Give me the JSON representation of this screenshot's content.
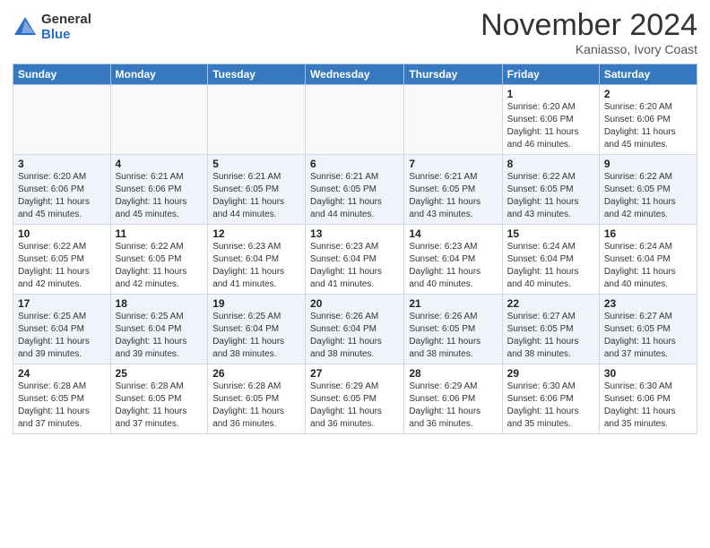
{
  "header": {
    "logo_general": "General",
    "logo_blue": "Blue",
    "month_title": "November 2024",
    "location": "Kaniasso, Ivory Coast"
  },
  "weekdays": [
    "Sunday",
    "Monday",
    "Tuesday",
    "Wednesday",
    "Thursday",
    "Friday",
    "Saturday"
  ],
  "weeks": [
    [
      {
        "day": "",
        "info": ""
      },
      {
        "day": "",
        "info": ""
      },
      {
        "day": "",
        "info": ""
      },
      {
        "day": "",
        "info": ""
      },
      {
        "day": "",
        "info": ""
      },
      {
        "day": "1",
        "info": "Sunrise: 6:20 AM\nSunset: 6:06 PM\nDaylight: 11 hours\nand 46 minutes."
      },
      {
        "day": "2",
        "info": "Sunrise: 6:20 AM\nSunset: 6:06 PM\nDaylight: 11 hours\nand 45 minutes."
      }
    ],
    [
      {
        "day": "3",
        "info": "Sunrise: 6:20 AM\nSunset: 6:06 PM\nDaylight: 11 hours\nand 45 minutes."
      },
      {
        "day": "4",
        "info": "Sunrise: 6:21 AM\nSunset: 6:06 PM\nDaylight: 11 hours\nand 45 minutes."
      },
      {
        "day": "5",
        "info": "Sunrise: 6:21 AM\nSunset: 6:05 PM\nDaylight: 11 hours\nand 44 minutes."
      },
      {
        "day": "6",
        "info": "Sunrise: 6:21 AM\nSunset: 6:05 PM\nDaylight: 11 hours\nand 44 minutes."
      },
      {
        "day": "7",
        "info": "Sunrise: 6:21 AM\nSunset: 6:05 PM\nDaylight: 11 hours\nand 43 minutes."
      },
      {
        "day": "8",
        "info": "Sunrise: 6:22 AM\nSunset: 6:05 PM\nDaylight: 11 hours\nand 43 minutes."
      },
      {
        "day": "9",
        "info": "Sunrise: 6:22 AM\nSunset: 6:05 PM\nDaylight: 11 hours\nand 42 minutes."
      }
    ],
    [
      {
        "day": "10",
        "info": "Sunrise: 6:22 AM\nSunset: 6:05 PM\nDaylight: 11 hours\nand 42 minutes."
      },
      {
        "day": "11",
        "info": "Sunrise: 6:22 AM\nSunset: 6:05 PM\nDaylight: 11 hours\nand 42 minutes."
      },
      {
        "day": "12",
        "info": "Sunrise: 6:23 AM\nSunset: 6:04 PM\nDaylight: 11 hours\nand 41 minutes."
      },
      {
        "day": "13",
        "info": "Sunrise: 6:23 AM\nSunset: 6:04 PM\nDaylight: 11 hours\nand 41 minutes."
      },
      {
        "day": "14",
        "info": "Sunrise: 6:23 AM\nSunset: 6:04 PM\nDaylight: 11 hours\nand 40 minutes."
      },
      {
        "day": "15",
        "info": "Sunrise: 6:24 AM\nSunset: 6:04 PM\nDaylight: 11 hours\nand 40 minutes."
      },
      {
        "day": "16",
        "info": "Sunrise: 6:24 AM\nSunset: 6:04 PM\nDaylight: 11 hours\nand 40 minutes."
      }
    ],
    [
      {
        "day": "17",
        "info": "Sunrise: 6:25 AM\nSunset: 6:04 PM\nDaylight: 11 hours\nand 39 minutes."
      },
      {
        "day": "18",
        "info": "Sunrise: 6:25 AM\nSunset: 6:04 PM\nDaylight: 11 hours\nand 39 minutes."
      },
      {
        "day": "19",
        "info": "Sunrise: 6:25 AM\nSunset: 6:04 PM\nDaylight: 11 hours\nand 38 minutes."
      },
      {
        "day": "20",
        "info": "Sunrise: 6:26 AM\nSunset: 6:04 PM\nDaylight: 11 hours\nand 38 minutes."
      },
      {
        "day": "21",
        "info": "Sunrise: 6:26 AM\nSunset: 6:05 PM\nDaylight: 11 hours\nand 38 minutes."
      },
      {
        "day": "22",
        "info": "Sunrise: 6:27 AM\nSunset: 6:05 PM\nDaylight: 11 hours\nand 38 minutes."
      },
      {
        "day": "23",
        "info": "Sunrise: 6:27 AM\nSunset: 6:05 PM\nDaylight: 11 hours\nand 37 minutes."
      }
    ],
    [
      {
        "day": "24",
        "info": "Sunrise: 6:28 AM\nSunset: 6:05 PM\nDaylight: 11 hours\nand 37 minutes."
      },
      {
        "day": "25",
        "info": "Sunrise: 6:28 AM\nSunset: 6:05 PM\nDaylight: 11 hours\nand 37 minutes."
      },
      {
        "day": "26",
        "info": "Sunrise: 6:28 AM\nSunset: 6:05 PM\nDaylight: 11 hours\nand 36 minutes."
      },
      {
        "day": "27",
        "info": "Sunrise: 6:29 AM\nSunset: 6:05 PM\nDaylight: 11 hours\nand 36 minutes."
      },
      {
        "day": "28",
        "info": "Sunrise: 6:29 AM\nSunset: 6:06 PM\nDaylight: 11 hours\nand 36 minutes."
      },
      {
        "day": "29",
        "info": "Sunrise: 6:30 AM\nSunset: 6:06 PM\nDaylight: 11 hours\nand 35 minutes."
      },
      {
        "day": "30",
        "info": "Sunrise: 6:30 AM\nSunset: 6:06 PM\nDaylight: 11 hours\nand 35 minutes."
      }
    ]
  ]
}
